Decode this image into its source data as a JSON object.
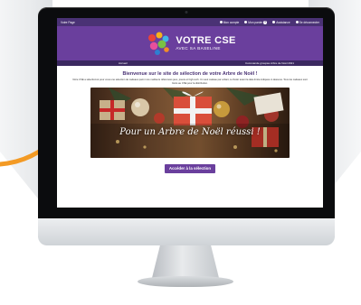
{
  "topbar": {
    "site_label": "Votre Page",
    "my_account": "Mon compte",
    "basket": "Mon panier",
    "basket_count": "0",
    "help": "Assistance",
    "logout": "Se déconnecter"
  },
  "header": {
    "title": "VOTRE CSE",
    "subtitle": "AVEC SA BASELINE"
  },
  "nav": {
    "home": "Accueil",
    "basket": "Commande groupée Arbre de Noël 2021"
  },
  "content": {
    "welcome": "Bienvenue sur le site de sélection de votre Arbre de Noël !",
    "intro": "Votre CSE a sélectionné pour vous une sélection de cadeaux parmi nos meilleurs références jeux, jouets et high-tech. Un seul cadeau par enfant, à choisir avant la date limite indiquée ci-dessous. Tous les cadeaux sont livrés au CSE pour la distribution.",
    "banner_text": "Pour un Arbre de Noël réussi !",
    "cta": "Accéder à la sélection"
  },
  "colors": {
    "brand_purple": "#6a3f9d",
    "topbar_purple": "#4a3275",
    "nav_purple": "#3b2860",
    "arrow_orange": "#f39a24"
  },
  "icons": [
    "arrow-icon",
    "user-icon",
    "cart-icon",
    "help-icon",
    "logout-icon"
  ]
}
